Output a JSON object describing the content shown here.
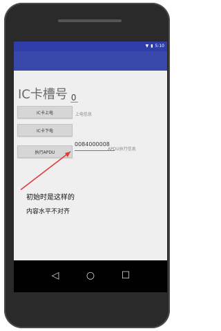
{
  "status": {
    "time": "5:10"
  },
  "title": {
    "label": "IC卡槽号",
    "slot_value": "0"
  },
  "buttons": {
    "power_on": "IC卡上电",
    "power_off": "IC卡下电",
    "exec_apdu": "执行APDU"
  },
  "labels": {
    "power_info": "上电信息",
    "apdu_info": "APDU执行信息"
  },
  "apdu": {
    "value": "0084000008"
  },
  "annotation": {
    "line1": "初始时是这样的",
    "line2": "内容水平不对齐",
    "arrow_color": "#e53935"
  },
  "nav": {
    "back": "◁",
    "home": "○",
    "recent": "☐"
  }
}
